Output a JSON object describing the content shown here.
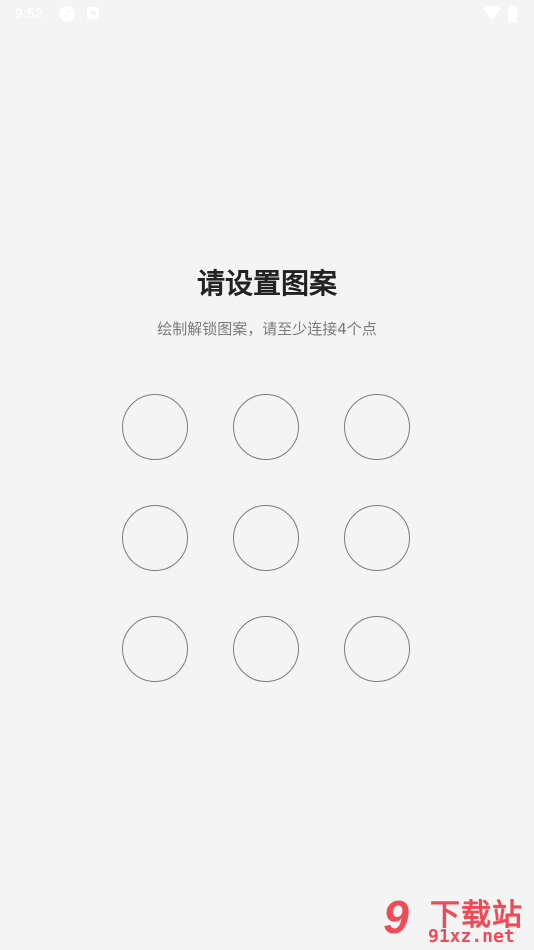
{
  "status_bar": {
    "time": "9:52",
    "icons": [
      "sync-icon",
      "notification-icon",
      "wifi-icon",
      "battery-icon"
    ]
  },
  "lock_setup": {
    "title": "请设置图案",
    "subtitle": "绘制解锁图案，请至少连接4个点",
    "dot_count": 9,
    "dot_border_color": "#7c7c7c"
  },
  "watermark": {
    "logo_text": "9",
    "name": "下载站",
    "url": "91xz.net",
    "color": "#ef4b56"
  },
  "colors": {
    "background": "#f4f4f4",
    "title": "#222222",
    "subtitle": "#7a7a7a"
  }
}
